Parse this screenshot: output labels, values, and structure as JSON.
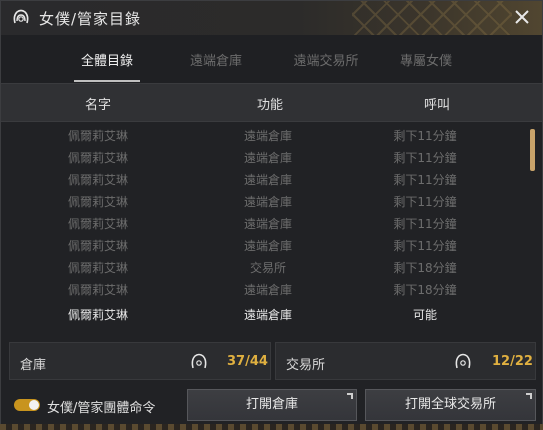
{
  "window": {
    "title": "女僕/管家目錄",
    "close_icon": "close-icon",
    "title_icon": "maid-icon"
  },
  "tabs": [
    {
      "label": "全體目錄",
      "active": true
    },
    {
      "label": "遠端倉庫",
      "active": false
    },
    {
      "label": "遠端交易所",
      "active": false
    },
    {
      "label": "專屬女僕",
      "active": false
    }
  ],
  "columns": {
    "name": "名字",
    "function": "功能",
    "call": "呼叫"
  },
  "rows": [
    {
      "name": "佩爾莉艾琳",
      "function": "遠端倉庫",
      "call": "剩下11分鐘",
      "highlight": false
    },
    {
      "name": "佩爾莉艾琳",
      "function": "遠端倉庫",
      "call": "剩下11分鐘",
      "highlight": false
    },
    {
      "name": "佩爾莉艾琳",
      "function": "遠端倉庫",
      "call": "剩下11分鐘",
      "highlight": false
    },
    {
      "name": "佩爾莉艾琳",
      "function": "遠端倉庫",
      "call": "剩下11分鐘",
      "highlight": false
    },
    {
      "name": "佩爾莉艾琳",
      "function": "遠端倉庫",
      "call": "剩下11分鐘",
      "highlight": false
    },
    {
      "name": "佩爾莉艾琳",
      "function": "遠端倉庫",
      "call": "剩下11分鐘",
      "highlight": false
    },
    {
      "name": "佩爾莉艾琳",
      "function": "交易所",
      "call": "剩下18分鐘",
      "highlight": false
    },
    {
      "name": "佩爾莉艾琳",
      "function": "遠端倉庫",
      "call": "剩下18分鐘",
      "highlight": false
    },
    {
      "name": "佩爾莉艾琳",
      "function": "遠端倉庫",
      "call": "可能",
      "highlight": true
    }
  ],
  "stats": {
    "warehouse": {
      "label": "倉庫",
      "value": "37/44"
    },
    "market": {
      "label": "交易所",
      "value": "12/22"
    }
  },
  "footer": {
    "toggle_label": "女僕/管家團體命令",
    "toggle_on": true,
    "open_warehouse": "打開倉庫",
    "open_market": "打開全球交易所"
  },
  "colors": {
    "accent": "#e0b040",
    "toggle": "#c8941e",
    "scroll": "#c8a36a"
  }
}
